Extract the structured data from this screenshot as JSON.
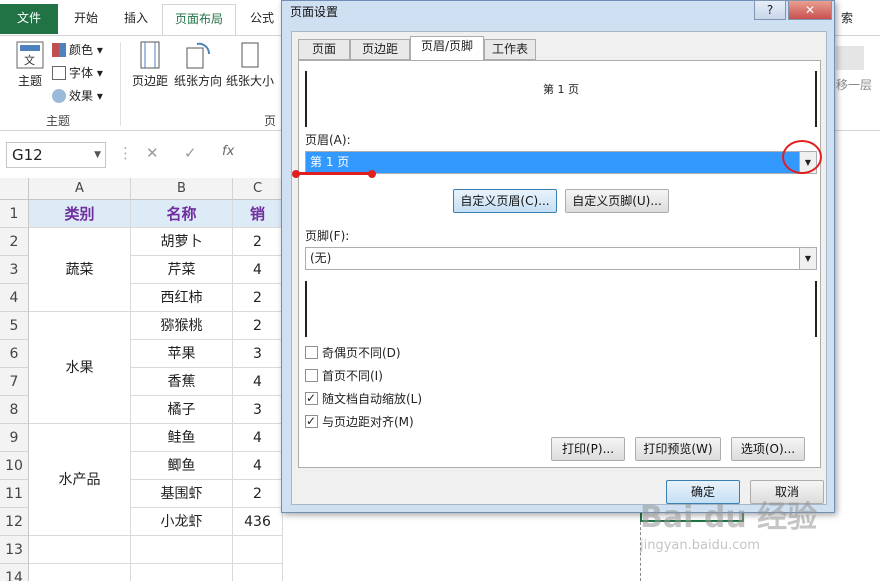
{
  "ribbon": {
    "tabs": [
      "文件",
      "开始",
      "插入",
      "页面布局",
      "公式",
      "索"
    ],
    "active_tab": "页面布局",
    "theme_group": {
      "label": "主题",
      "theme_btn": "主题",
      "colors": "颜色",
      "fonts": "字体",
      "effects": "效果"
    },
    "page_setup_group": {
      "label": "页",
      "margins": "页边距",
      "orientation": "纸张方向",
      "size": "纸张大小"
    },
    "move_down": "移一层"
  },
  "formula_bar": {
    "name_box": "G12",
    "fx": "fx"
  },
  "sheet": {
    "columns": [
      "A",
      "B",
      "C"
    ],
    "rows": [
      "1",
      "2",
      "3",
      "4",
      "5",
      "6",
      "7",
      "8",
      "9",
      "10",
      "11",
      "12",
      "13",
      "14"
    ],
    "header": {
      "a": "类别",
      "b": "名称",
      "c": "销"
    },
    "groups": [
      "蔬菜",
      "水果",
      "水产品"
    ],
    "items": [
      "胡萝卜",
      "芹菜",
      "西红柿",
      "猕猴桃",
      "苹果",
      "香蕉",
      "橘子",
      "鲑鱼",
      "鲫鱼",
      "基围虾",
      "小龙虾"
    ],
    "values": [
      "2",
      "4",
      "2",
      "2",
      "3",
      "4",
      "3",
      "4",
      "4",
      "2",
      "436"
    ]
  },
  "dialog": {
    "title": "页面设置",
    "help": "?",
    "close": "✕",
    "tabs": [
      "页面",
      "页边距",
      "页眉/页脚",
      "工作表"
    ],
    "active_tab": "页眉/页脚",
    "header_preview": "第 1 页",
    "header_label": "页眉(A):",
    "header_value": "第 1 页",
    "custom_header": "自定义页眉(C)...",
    "custom_footer": "自定义页脚(U)...",
    "footer_label": "页脚(F):",
    "footer_value": "(无)",
    "checkboxes": [
      {
        "label": "奇偶页不同(D)",
        "checked": false
      },
      {
        "label": "首页不同(I)",
        "checked": false
      },
      {
        "label": "随文档自动缩放(L)",
        "checked": true
      },
      {
        "label": "与页边距对齐(M)",
        "checked": true
      }
    ],
    "print": "打印(P)...",
    "print_preview": "打印预览(W)",
    "options": "选项(O)...",
    "ok": "确定",
    "cancel": "取消"
  },
  "watermark": {
    "brand": "Bai du 经验",
    "url": "jingyan.baidu.com"
  },
  "colors": {
    "excel_green": "#217346",
    "header_fill": "#ddebf7",
    "header_text": "#7030a0",
    "annotation": "#e02020",
    "selection": "#3399ff"
  }
}
